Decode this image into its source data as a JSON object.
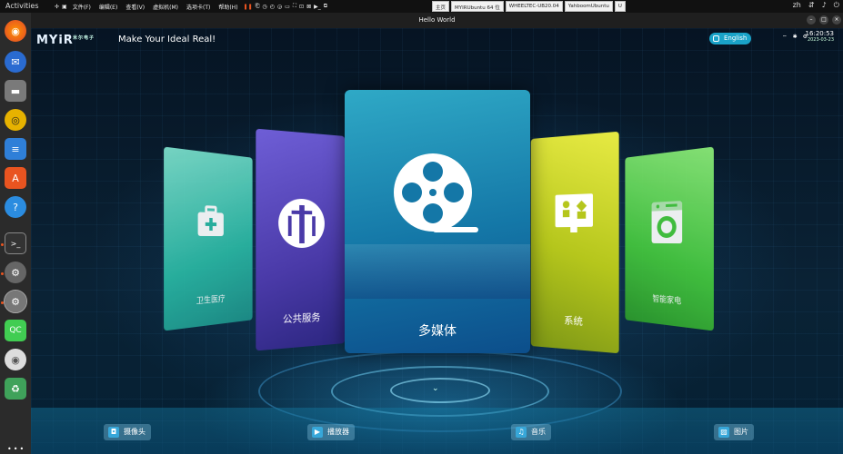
{
  "topbar": {
    "activities": "Activities",
    "lang": "zh"
  },
  "vmware": {
    "menus": [
      "文件(F)",
      "编辑(E)",
      "查看(V)",
      "虚拟机(M)",
      "选项卡(T)",
      "帮助(H)"
    ],
    "tabs": [
      "主页",
      "MYIRUbuntu 64 位",
      "WHEELTEC-UB20.04",
      "YahboomUbuntu",
      "U"
    ]
  },
  "window": {
    "title": "Hello World"
  },
  "header": {
    "logo": "MYiR",
    "logo_small": "米尔电子",
    "slogan": "Make Your Ideal Real!",
    "lang_button": "English",
    "time": "16:20:53",
    "date": "2023-03-23"
  },
  "cards": {
    "health": "卫生医疗",
    "public": "公共服务",
    "media": "多媒体",
    "system": "系统",
    "home": "智能家电"
  },
  "bottom": {
    "camera": "摄像头",
    "player": "播放器",
    "music": "音乐",
    "pictures": "图片"
  },
  "colors": {
    "accent": "#1aa3c8",
    "health": "#29b8a4",
    "public": "#4a3aa8",
    "media": "#1477a7",
    "system": "#b5c61c",
    "home": "#44c93d"
  },
  "icons": {
    "health": "medical-kit-icon",
    "public": "public-service-icon",
    "media": "film-reel-icon",
    "system": "system-apps-icon",
    "home": "washing-machine-icon"
  }
}
